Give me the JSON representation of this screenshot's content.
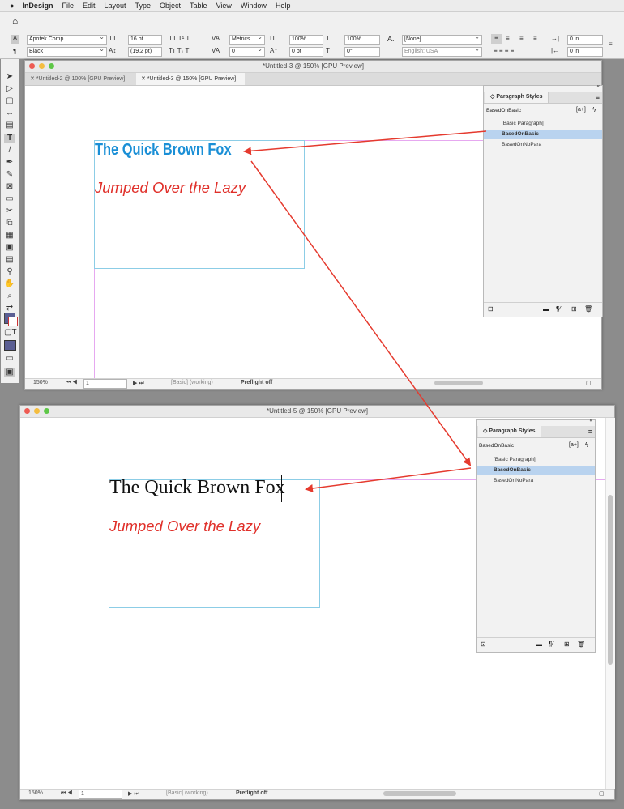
{
  "menubar": {
    "app": "InDesign",
    "items": [
      "File",
      "Edit",
      "Layout",
      "Type",
      "Object",
      "Table",
      "View",
      "Window",
      "Help"
    ]
  },
  "control": {
    "font_family": "Apotek Comp",
    "font_size": "16 pt",
    "leading": "(19.2 pt)",
    "kerning": "Metrics",
    "tracking": "0",
    "vscale": "100%",
    "hscale": "100%",
    "baseline": "0 pt",
    "skew": "0°",
    "char_style": "[None]",
    "language": "English: USA",
    "color": "Black",
    "indent_left": "0 in",
    "indent_right": "0 in"
  },
  "window_top": {
    "title": "*Untitled-3 @ 150% [GPU Preview]",
    "tabs": [
      "*Untitled-2 @ 100% [GPU Preview]",
      "*Untitled-3 @ 150% [GPU Preview]"
    ],
    "headline": "The Quick Brown Fox",
    "subline": "Jumped Over the Lazy",
    "status": {
      "zoom": "150%",
      "page": "1",
      "master": "[Basic] (working)",
      "preflight": "Preflight off"
    }
  },
  "window_bottom": {
    "title": "*Untitled-5 @ 150% [GPU Preview]",
    "headline": "The Quick Brown Fox",
    "subline": "Jumped Over the Lazy",
    "status": {
      "zoom": "150%",
      "page": "1",
      "master": "[Basic] (working)",
      "preflight": "Preflight off"
    }
  },
  "panel": {
    "title": "Paragraph Styles",
    "current": "BasedOnBasic",
    "new_style_glyph": "[a+]",
    "styles": [
      "[Basic Paragraph]",
      "BasedOnBasic",
      "BasedOnNoPara"
    ]
  },
  "colors": {
    "headline_top": "#1a8fd6",
    "subline": "#e0302a",
    "arrow": "#e53a2e",
    "selection": "#b9d3ef"
  }
}
